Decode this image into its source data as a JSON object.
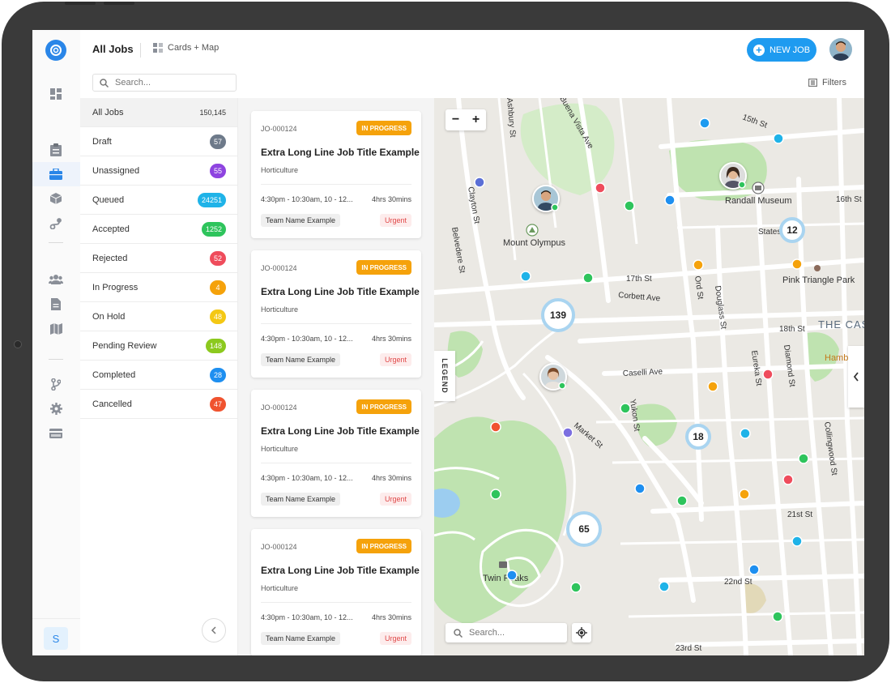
{
  "header": {
    "title": "All Jobs",
    "view_mode": "Cards + Map",
    "new_job_label": "NEW JOB"
  },
  "search": {
    "placeholder": "Search..."
  },
  "filters_label": "Filters",
  "sidebar_footer": {
    "initial": "S"
  },
  "statuses": [
    {
      "label": "All Jobs",
      "count": "150,145",
      "color": ""
    },
    {
      "label": "Draft",
      "count": "57",
      "color": "#6e7a8a"
    },
    {
      "label": "Unassigned",
      "count": "55",
      "color": "#8e44e0"
    },
    {
      "label": "Queued",
      "count": "24251",
      "color": "#1fb3e8"
    },
    {
      "label": "Accepted",
      "count": "1252",
      "color": "#2ec45c"
    },
    {
      "label": "Rejected",
      "count": "52",
      "color": "#ef4c5c"
    },
    {
      "label": "In Progress",
      "count": "4",
      "color": "#f5a20b"
    },
    {
      "label": "On Hold",
      "count": "48",
      "color": "#f4c814"
    },
    {
      "label": "Pending Review",
      "count": "148",
      "color": "#8cc91e"
    },
    {
      "label": "Completed",
      "count": "28",
      "color": "#1e8ff0"
    },
    {
      "label": "Cancelled",
      "count": "47",
      "color": "#f0532f"
    }
  ],
  "cards": [
    {
      "id": "JO-000124",
      "status": "IN PROGRESS",
      "title": "Extra Long Line Job Title Example",
      "category": "Horticulture",
      "time": "4:30pm - 10:30am, 10 - 12...",
      "duration": "4hrs 30mins",
      "team": "Team Name Example",
      "priority": "Urgent"
    },
    {
      "id": "JO-000124",
      "status": "IN PROGRESS",
      "title": "Extra Long Line Job Title Example",
      "category": "Horticulture",
      "time": "4:30pm - 10:30am, 10 - 12...",
      "duration": "4hrs 30mins",
      "team": "Team Name Example",
      "priority": "Urgent"
    },
    {
      "id": "JO-000124",
      "status": "IN PROGRESS",
      "title": "Extra Long Line Job Title Example",
      "category": "Horticulture",
      "time": "4:30pm - 10:30am, 10 - 12...",
      "duration": "4hrs 30mins",
      "team": "Team Name Example",
      "priority": "Urgent"
    },
    {
      "id": "JO-000124",
      "status": "IN PROGRESS",
      "title": "Extra Long Line Job Title Example",
      "category": "Horticulture",
      "time": "4:30pm - 10:30am, 10 - 12...",
      "duration": "4hrs 30mins",
      "team": "Team Name Example",
      "priority": "Urgent"
    }
  ],
  "map": {
    "legend_label": "LEGEND",
    "search_placeholder": "Search...",
    "clusters": [
      "12",
      "139",
      "18",
      "65"
    ],
    "streets": [
      "Clayton St",
      "Belvedere St",
      "17th St",
      "Corbett Ave",
      "Ord St",
      "Douglass St",
      "18th St",
      "Caselli Ave",
      "Market St",
      "Yukon St",
      "Eureka St",
      "Diamond St",
      "Collingwood St",
      "21st St",
      "22nd St",
      "23rd St",
      "15th St",
      "16th St",
      "States",
      "Ashbury St",
      "Buena Vista Ave"
    ],
    "places": [
      "Mount Olympus",
      "Randall Museum",
      "Pink Triangle Park",
      "Twin Peaks",
      "THE CAS",
      "Hamb"
    ]
  },
  "colors": {
    "accent": "#1e9bf0",
    "in_progress": "#f5a20b",
    "urgent": "#e04848",
    "map_green": "#bfe3b0"
  }
}
